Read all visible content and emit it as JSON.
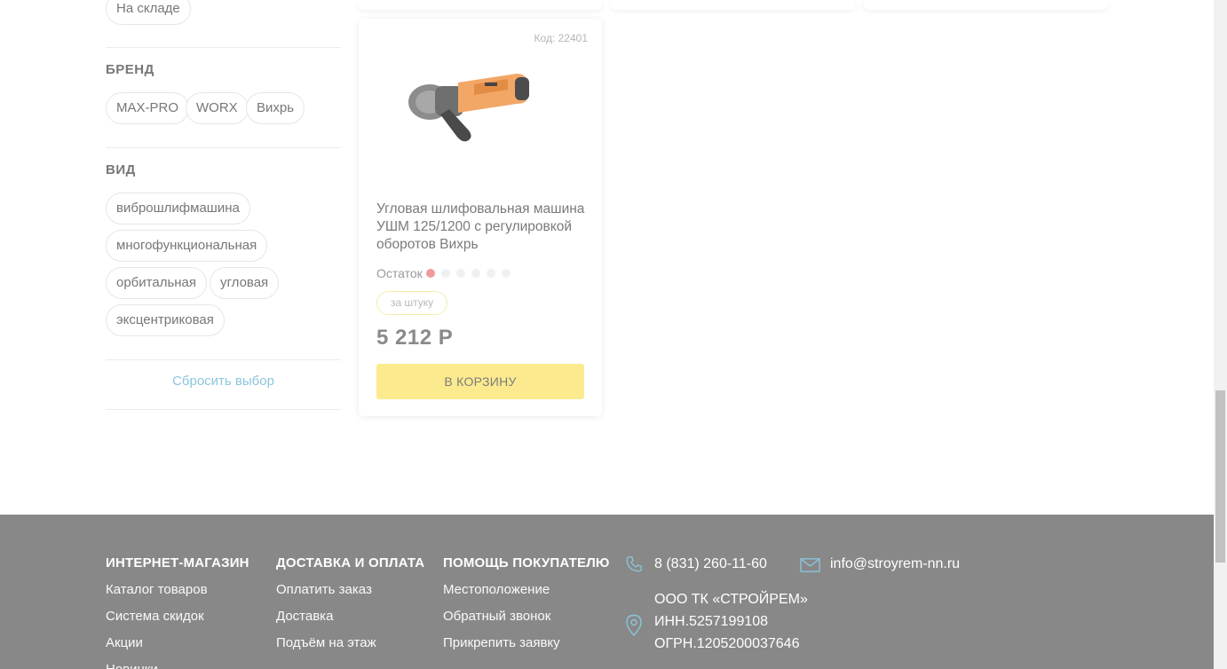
{
  "filters": {
    "availability_chip": "На складе",
    "brand": {
      "title": "БРЕНД",
      "options": [
        "MAX-PRO",
        "WORX",
        "Вихрь"
      ]
    },
    "type": {
      "title": "ВИД",
      "options": [
        "виброшлифмашина",
        "многофункциональная",
        "орбитальная",
        "угловая",
        "эксцентриковая"
      ]
    },
    "reset_label": "Сбросить выбор"
  },
  "product": {
    "code": "Код: 22401",
    "name": "Угловая шлифовальная машина УШМ 125/1200 с регулировкой оборотов Вихрь",
    "stock_label": "Остаток",
    "stock_level": 1,
    "stock_max": 6,
    "unit": "за штуку",
    "price": "5 212 Р",
    "cart_label": "В КОРЗИНУ"
  },
  "footer": {
    "columns": [
      {
        "title": "ИНТЕРНЕТ-МАГАЗИН",
        "links": [
          "Каталог товаров",
          "Система скидок",
          "Акции",
          "Новинки"
        ]
      },
      {
        "title": "ДОСТАВКА И ОПЛАТА",
        "links": [
          "Оплатить заказ",
          "Доставка",
          "Подъём на этаж"
        ]
      },
      {
        "title": "ПОМОЩЬ ПОКУПАТЕЛЮ",
        "links": [
          "Местоположение",
          "Обратный звонок",
          "Прикрепить заявку"
        ]
      }
    ],
    "phone": "8 (831) 260-11-60",
    "email": "info@stroyrem-nn.ru",
    "company": "ООО ТК «СТРОЙРЕМ»",
    "inn": "ИНН.5257199108",
    "ogrn": "ОГРН.1205200037646"
  },
  "colors": {
    "footer_bg": "#888888",
    "cart_button": "#fbea8e",
    "stock_dot_active": "#f09a9a",
    "accent_link": "#8cc6dc",
    "icon": "#8cc6dc"
  },
  "icons": [
    "phone-icon",
    "mail-icon",
    "location-pin-icon"
  ]
}
